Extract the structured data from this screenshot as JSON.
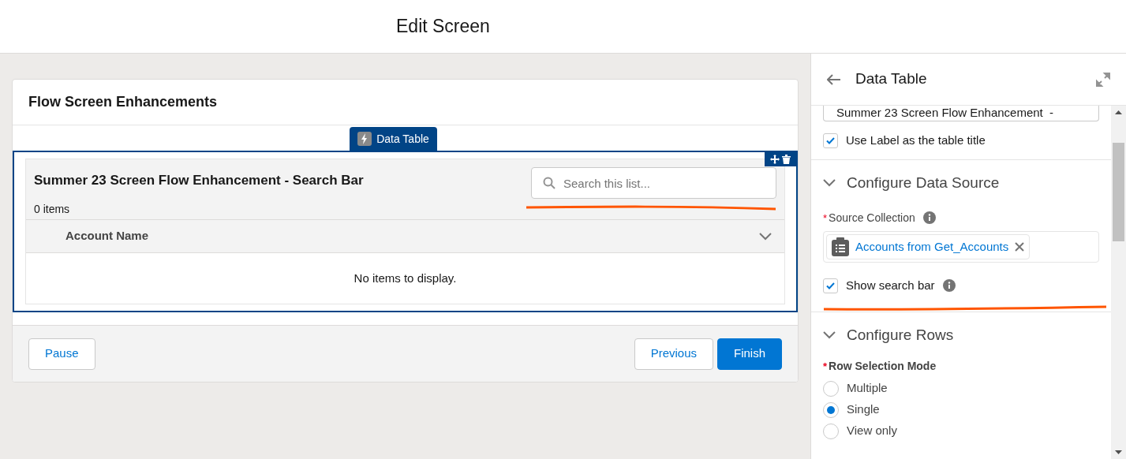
{
  "header": {
    "title": "Edit Screen"
  },
  "screen": {
    "title": "Flow Screen Enhancements",
    "component_tab": "Data Table",
    "table": {
      "title": "Summer 23 Screen Flow Enhancement - Search Bar",
      "count": "0 items",
      "search_placeholder": "Search this list...",
      "columns": [
        {
          "label": "Account Name"
        }
      ],
      "empty_message": "No items to display."
    },
    "buttons": [
      {
        "label": "Pause",
        "kind": "neutral"
      },
      {
        "label": "Previous",
        "kind": "neutral"
      },
      {
        "label": "Finish",
        "kind": "brand"
      }
    ]
  },
  "panel": {
    "title": "Data Table",
    "label_value": "Summer 23 Screen Flow Enhancement  -",
    "use_label": {
      "label": "Use Label as the table title",
      "checked": true
    },
    "data_source": {
      "heading": "Configure Data Source",
      "expanded": true,
      "source_label": "Source Collection",
      "required": "*",
      "pill": "Accounts from Get_Accounts",
      "show_search": {
        "label": "Show search bar",
        "checked": true
      }
    },
    "rows": {
      "heading": "Configure Rows",
      "expanded": true,
      "mode_label": "Row Selection Mode",
      "required": "*",
      "options": [
        {
          "label": "Multiple",
          "selected": false
        },
        {
          "label": "Single",
          "selected": true
        },
        {
          "label": "View only",
          "selected": false
        }
      ]
    }
  }
}
